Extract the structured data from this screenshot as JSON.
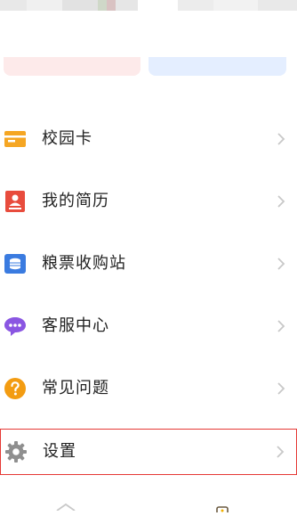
{
  "colors": {
    "accent_red": "#e53935",
    "card_pink": "#fdeaea",
    "card_blue": "#e4eeff",
    "chevron": "#c8c8c8"
  },
  "menu": {
    "items": [
      {
        "label": "校园卡",
        "icon": "card-icon",
        "icon_color": "#f5a623"
      },
      {
        "label": "我的简历",
        "icon": "resume-icon",
        "icon_color": "#e84c3d"
      },
      {
        "label": "粮票收购站",
        "icon": "coins-icon",
        "icon_color": "#3a7be0"
      },
      {
        "label": "客服中心",
        "icon": "chat-icon",
        "icon_color": "#8a56e2"
      },
      {
        "label": "常见问题",
        "icon": "question-icon",
        "icon_color": "#f39c12"
      },
      {
        "label": "设置",
        "icon": "gear-icon",
        "icon_color": "#8f8f8f"
      }
    ]
  },
  "bottom_nav": {
    "icons": [
      "home-icon",
      "profile-icon"
    ]
  }
}
